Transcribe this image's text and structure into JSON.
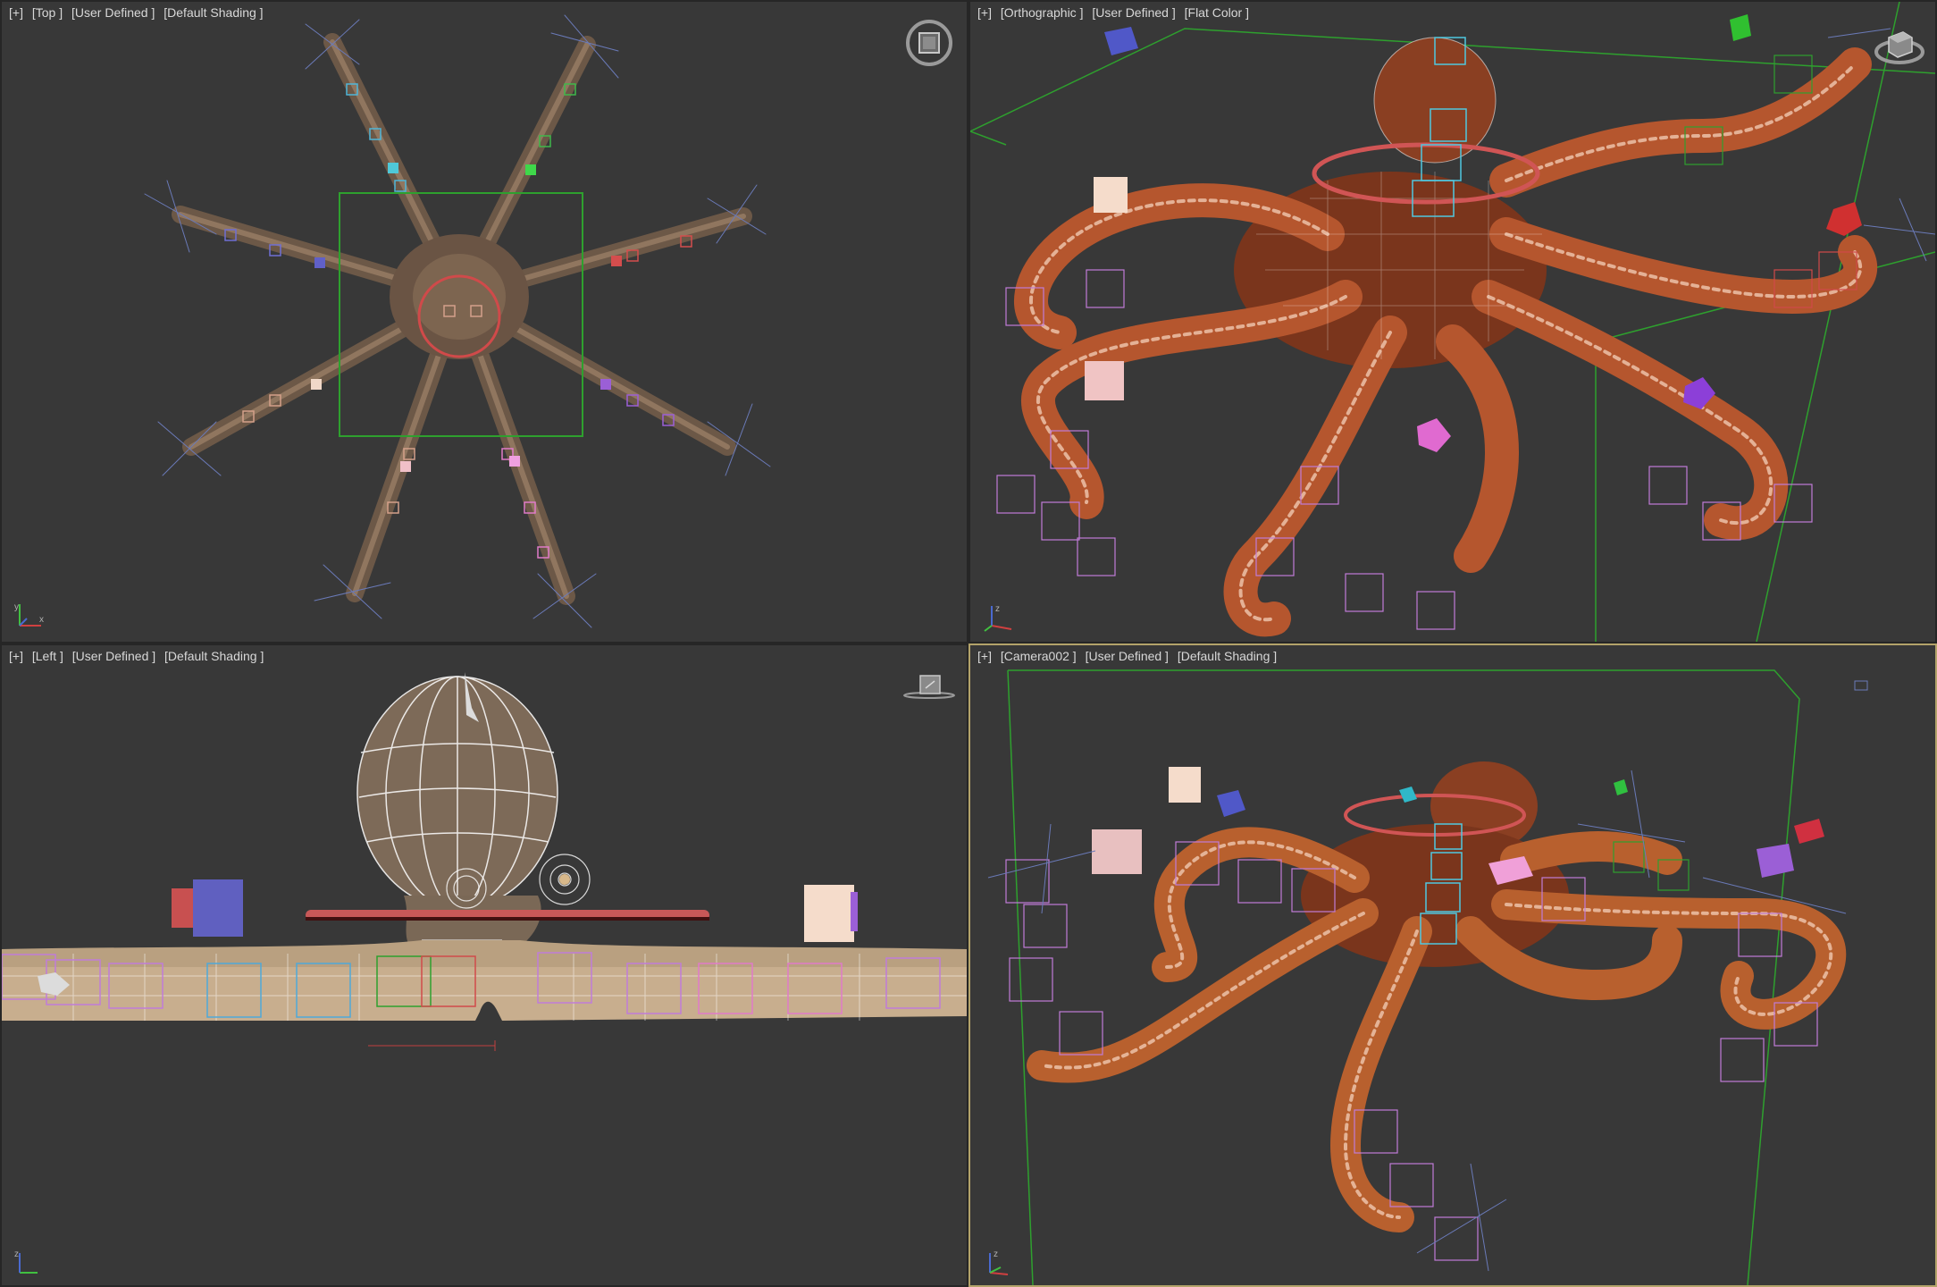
{
  "viewports": [
    {
      "id": "top",
      "labels": [
        "[+]",
        "[Top ]",
        "[User Defined ]",
        "[Default Shading ]"
      ],
      "active": false
    },
    {
      "id": "orthographic",
      "labels": [
        "[+]",
        "[Orthographic ]",
        "[User Defined ]",
        "[Flat Color ]"
      ],
      "active": false
    },
    {
      "id": "left",
      "labels": [
        "[+]",
        "[Left ]",
        "[User Defined ]",
        "[Default Shading ]"
      ],
      "active": false
    },
    {
      "id": "camera",
      "labels": [
        "[+]",
        "[Camera002 ]",
        "[User Defined ]",
        "[Default Shading ]"
      ],
      "active": true
    }
  ],
  "navcube_icons": [
    "viewcube-icon",
    "viewcube-icon",
    "viewcube-icon"
  ],
  "axis_letters": {
    "x": "x",
    "y": "y",
    "z": "z"
  },
  "colors": {
    "viewport_bg": "#383838",
    "active_border": "#b3a36a",
    "label_text": "#d8d8d8",
    "selection_green": "#2ea02e",
    "octopus_flesh": "#8a3f22"
  }
}
